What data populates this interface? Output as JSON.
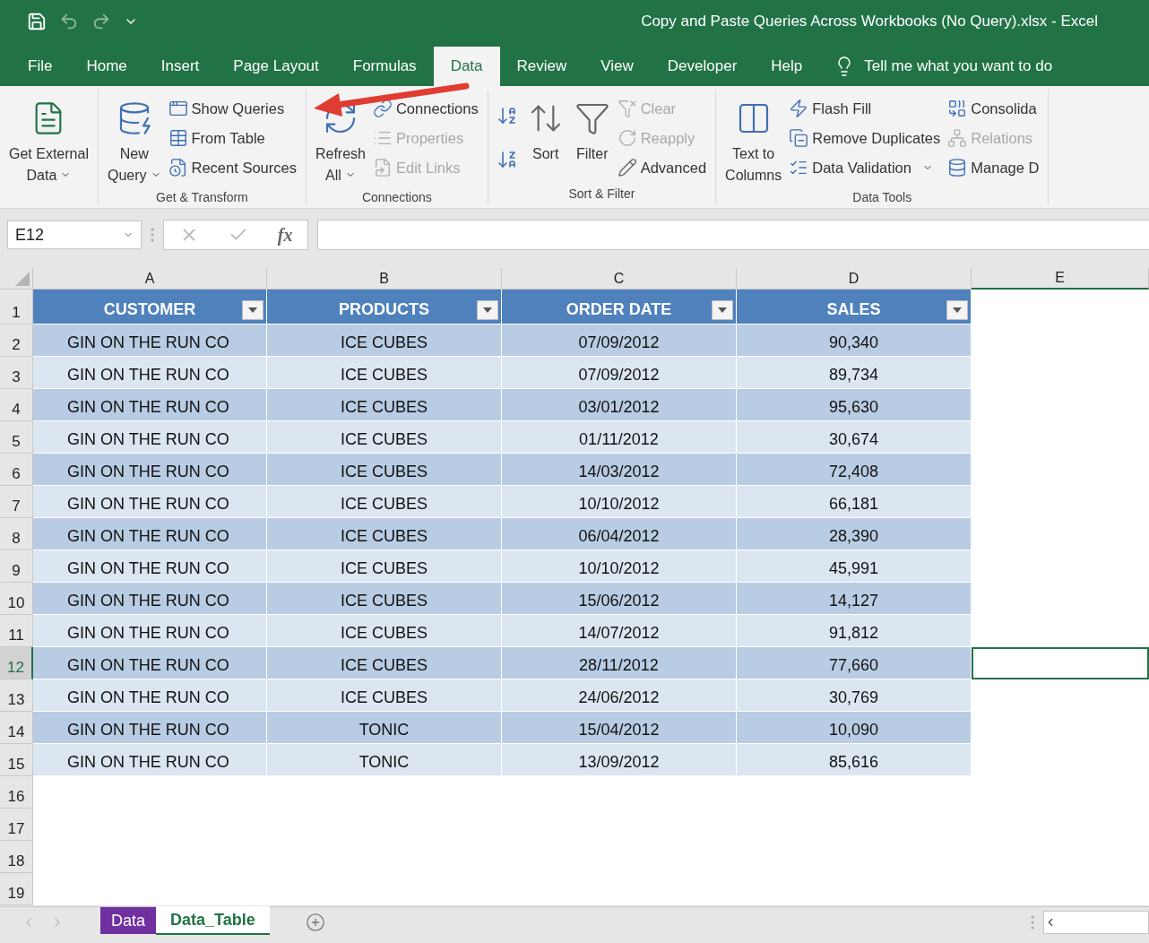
{
  "title_bar": {
    "title": "Copy and Paste Queries Across Workbooks (No Query).xlsx  -  Excel"
  },
  "tabs": [
    {
      "label": "File",
      "selected": false
    },
    {
      "label": "Home",
      "selected": false
    },
    {
      "label": "Insert",
      "selected": false
    },
    {
      "label": "Page Layout",
      "selected": false
    },
    {
      "label": "Formulas",
      "selected": false
    },
    {
      "label": "Data",
      "selected": true
    },
    {
      "label": "Review",
      "selected": false
    },
    {
      "label": "View",
      "selected": false
    },
    {
      "label": "Developer",
      "selected": false
    },
    {
      "label": "Help",
      "selected": false
    }
  ],
  "tell_me": "Tell me what you want to do",
  "ribbon": {
    "groups": [
      {
        "items": [
          {
            "kind": "large",
            "lines": [
              "Get External",
              "Data"
            ],
            "has_menu": true,
            "disabled": false
          }
        ]
      },
      {
        "label": "Get & Transform",
        "items": [
          {
            "kind": "large",
            "lines": [
              "New",
              "Query"
            ],
            "has_menu": true,
            "disabled": false
          },
          {
            "kind": "small",
            "label": "Show Queries",
            "has_menu": false,
            "disabled": false
          },
          {
            "kind": "small",
            "label": "From Table",
            "has_menu": false,
            "disabled": false
          },
          {
            "kind": "small",
            "label": "Recent Sources",
            "has_menu": false,
            "disabled": false
          }
        ]
      },
      {
        "label": "Connections",
        "items": [
          {
            "kind": "large",
            "lines": [
              "Refresh",
              "All"
            ],
            "has_menu": true,
            "disabled": false
          },
          {
            "kind": "small",
            "label": "Connections",
            "has_menu": false,
            "disabled": false
          },
          {
            "kind": "small",
            "label": "Properties",
            "has_menu": false,
            "disabled": true
          },
          {
            "kind": "small",
            "label": "Edit Links",
            "has_menu": false,
            "disabled": true
          }
        ]
      },
      {
        "label": "Sort & Filter",
        "items": [
          {
            "kind": "icon",
            "disabled": false
          },
          {
            "kind": "icon",
            "disabled": false
          },
          {
            "kind": "large",
            "lines": [
              "Sort"
            ],
            "has_menu": false,
            "disabled": false
          },
          {
            "kind": "large",
            "lines": [
              "Filter"
            ],
            "has_menu": false,
            "disabled": false
          },
          {
            "kind": "small",
            "label": "Clear",
            "has_menu": false,
            "disabled": true
          },
          {
            "kind": "small",
            "label": "Reapply",
            "has_menu": false,
            "disabled": true
          },
          {
            "kind": "small",
            "label": "Advanced",
            "has_menu": false,
            "disabled": false
          }
        ]
      },
      {
        "label": "Data Tools",
        "items": [
          {
            "kind": "large",
            "lines": [
              "Text to",
              "Columns"
            ],
            "has_menu": false,
            "disabled": false
          },
          {
            "kind": "small",
            "label": "Flash Fill",
            "has_menu": false,
            "disabled": false
          },
          {
            "kind": "small",
            "label": "Remove Duplicates",
            "has_menu": false,
            "disabled": false
          },
          {
            "kind": "small",
            "label": "Data Validation",
            "has_menu": true,
            "disabled": false
          },
          {
            "kind": "small",
            "label": "Consolida",
            "has_menu": false,
            "disabled": false
          },
          {
            "kind": "small",
            "label": "Relations",
            "has_menu": false,
            "disabled": true
          },
          {
            "kind": "small",
            "label": "Manage D",
            "has_menu": false,
            "disabled": false
          }
        ]
      }
    ]
  },
  "formula_bar": {
    "name_box": "E12",
    "fx": "fx"
  },
  "sheet": {
    "columns": [
      {
        "label": "A",
        "selected": false
      },
      {
        "label": "B",
        "selected": false
      },
      {
        "label": "C",
        "selected": false
      },
      {
        "label": "D",
        "selected": false
      },
      {
        "label": "E",
        "selected": true
      }
    ],
    "headers": [
      "CUSTOMER",
      "PRODUCTS",
      "ORDER DATE",
      "SALES"
    ],
    "rows": [
      {
        "number": "2",
        "cells": [
          "GIN ON THE RUN CO",
          "ICE CUBES",
          "07/09/2012",
          "90,340"
        ],
        "selected": false
      },
      {
        "number": "3",
        "cells": [
          "GIN ON THE RUN CO",
          "ICE CUBES",
          "07/09/2012",
          "89,734"
        ],
        "selected": false
      },
      {
        "number": "4",
        "cells": [
          "GIN ON THE RUN CO",
          "ICE CUBES",
          "03/01/2012",
          "95,630"
        ],
        "selected": false
      },
      {
        "number": "5",
        "cells": [
          "GIN ON THE RUN CO",
          "ICE CUBES",
          "01/11/2012",
          "30,674"
        ],
        "selected": false
      },
      {
        "number": "6",
        "cells": [
          "GIN ON THE RUN CO",
          "ICE CUBES",
          "14/03/2012",
          "72,408"
        ],
        "selected": false
      },
      {
        "number": "7",
        "cells": [
          "GIN ON THE RUN CO",
          "ICE CUBES",
          "10/10/2012",
          "66,181"
        ],
        "selected": false
      },
      {
        "number": "8",
        "cells": [
          "GIN ON THE RUN CO",
          "ICE CUBES",
          "06/04/2012",
          "28,390"
        ],
        "selected": false
      },
      {
        "number": "9",
        "cells": [
          "GIN ON THE RUN CO",
          "ICE CUBES",
          "10/10/2012",
          "45,991"
        ],
        "selected": false
      },
      {
        "number": "10",
        "cells": [
          "GIN ON THE RUN CO",
          "ICE CUBES",
          "15/06/2012",
          "14,127"
        ],
        "selected": false
      },
      {
        "number": "11",
        "cells": [
          "GIN ON THE RUN CO",
          "ICE CUBES",
          "14/07/2012",
          "91,812"
        ],
        "selected": false
      },
      {
        "number": "12",
        "cells": [
          "GIN ON THE RUN CO",
          "ICE CUBES",
          "28/11/2012",
          "77,660"
        ],
        "selected": true
      },
      {
        "number": "13",
        "cells": [
          "GIN ON THE RUN CO",
          "ICE CUBES",
          "24/06/2012",
          "30,769"
        ],
        "selected": false
      },
      {
        "number": "14",
        "cells": [
          "GIN ON THE RUN CO",
          "TONIC",
          "15/04/2012",
          "10,090"
        ],
        "selected": false
      },
      {
        "number": "15",
        "cells": [
          "GIN ON THE RUN CO",
          "TONIC",
          "13/09/2012",
          "85,616"
        ],
        "selected": false
      }
    ],
    "header_row_number": "1",
    "empty_rows": [
      "16",
      "17",
      "18",
      "19"
    ]
  },
  "sheet_tabs": [
    {
      "label": "Data",
      "selected": false,
      "color": "#7030a0"
    },
    {
      "label": "Data_Table",
      "selected": true,
      "color": "#ffffff"
    }
  ]
}
